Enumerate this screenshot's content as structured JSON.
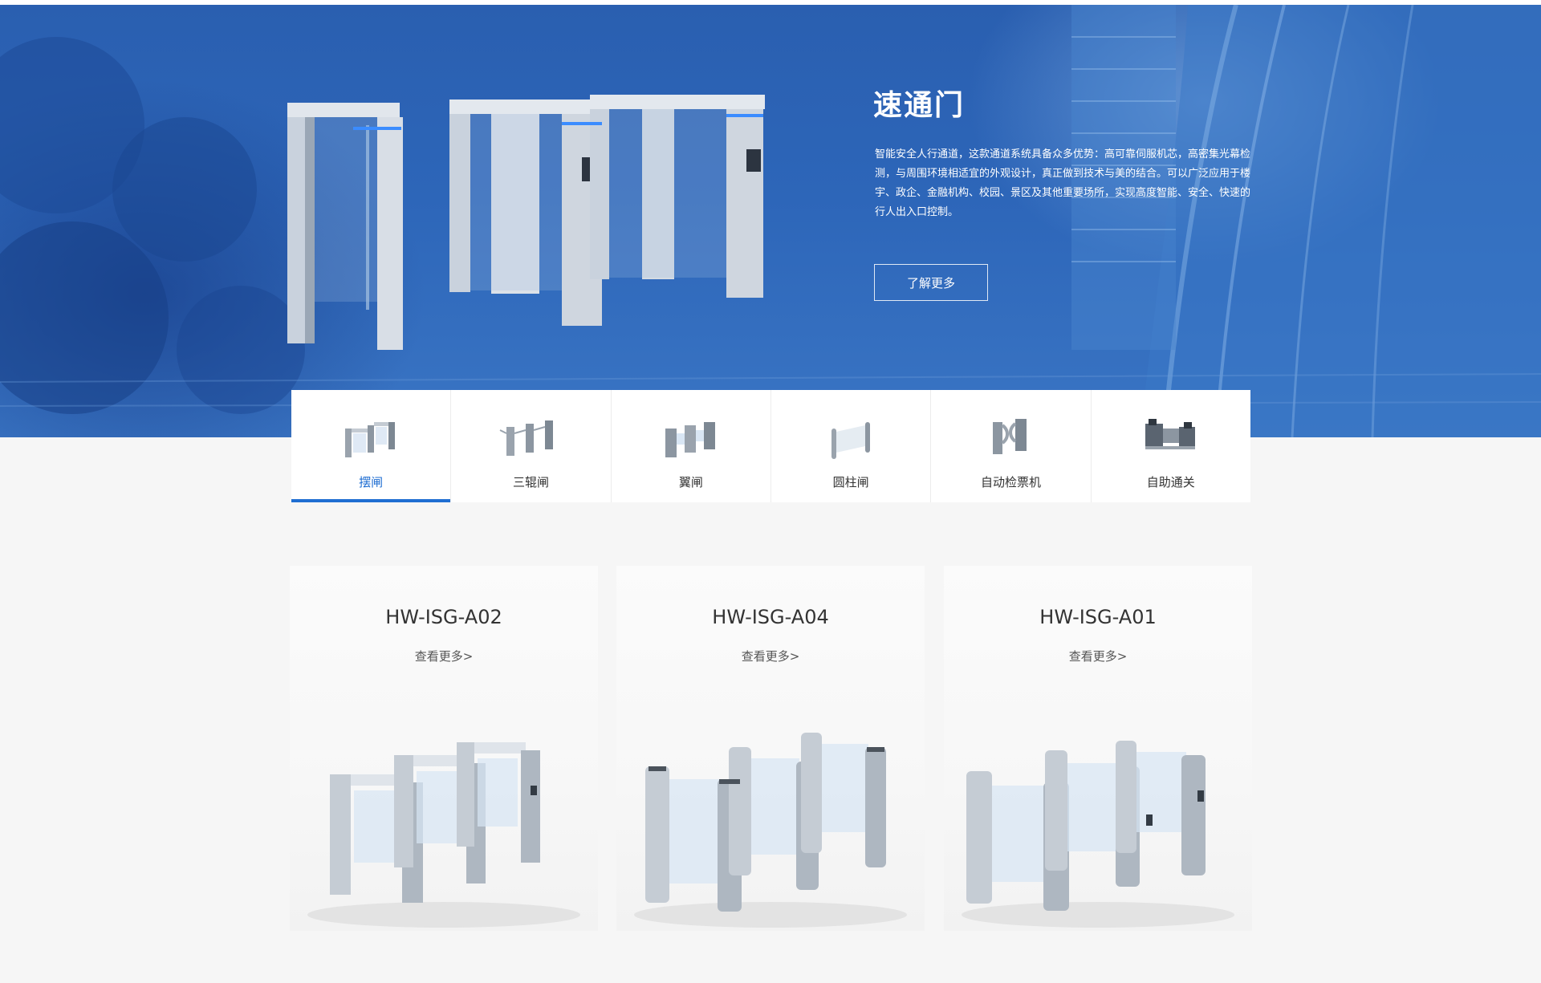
{
  "hero": {
    "title": "速通门",
    "description": "智能安全人行通道，这款通道系统具备众多优势：高可靠伺服机芯，高密集光幕检测，与周围环境相适宜的外观设计，真正做到技术与美的结合。可以广泛应用于楼宇、政企、金融机构、校园、景区及其他重要场所，实现高度智能、安全、快速的行人出入口控制。",
    "button_label": "了解更多"
  },
  "tabs": [
    {
      "label": "摆闸",
      "icon": "swing-gate-icon",
      "active": true
    },
    {
      "label": "三辊闸",
      "icon": "tripod-turnstile-icon",
      "active": false
    },
    {
      "label": "翼闸",
      "icon": "flap-barrier-icon",
      "active": false
    },
    {
      "label": "圆柱闸",
      "icon": "cylinder-gate-icon",
      "active": false
    },
    {
      "label": "自动检票机",
      "icon": "ticket-checker-icon",
      "active": false
    },
    {
      "label": "自助通关",
      "icon": "self-service-clearance-icon",
      "active": false
    }
  ],
  "products": [
    {
      "model": "HW-ISG-A02",
      "link": "查看更多>"
    },
    {
      "model": "HW-ISG-A04",
      "link": "查看更多>"
    },
    {
      "model": "HW-ISG-A01",
      "link": "查看更多>"
    }
  ],
  "colors": {
    "accent": "#1f6ed2",
    "hero_blue": "#2d66b9",
    "page_background": "#f6f6f6"
  }
}
